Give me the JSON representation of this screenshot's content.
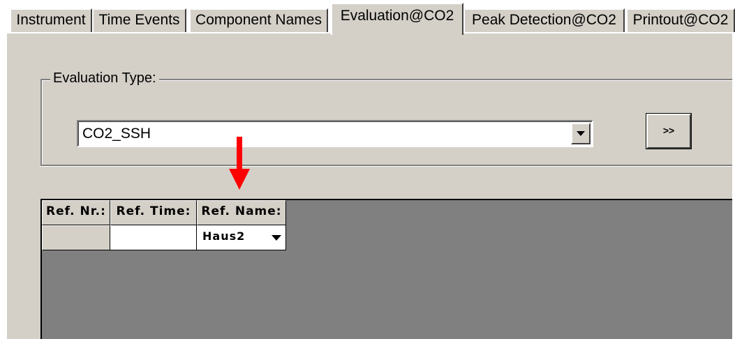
{
  "tabs": [
    {
      "label": "Instrument",
      "active": false
    },
    {
      "label": "Time Events",
      "active": false
    },
    {
      "label": "Component Names",
      "active": false
    },
    {
      "label": "Evaluation@CO2",
      "active": true
    },
    {
      "label": "Peak Detection@CO2",
      "active": false
    },
    {
      "label": "Printout@CO2",
      "active": false
    }
  ],
  "evaluation": {
    "group_label": "Evaluation Type:",
    "selected_type": "CO2_SSH",
    "more_button_label": ">>"
  },
  "ref_table": {
    "columns": [
      "Ref. Nr.:",
      "Ref. Time:",
      "Ref. Name:"
    ],
    "rows": [
      {
        "nr": "",
        "time": "",
        "name": "Haus2"
      }
    ]
  },
  "colors": {
    "panel_background": "#d4d0c8",
    "grid_background": "#808080",
    "annotation_arrow": "#ff0000"
  },
  "icons": {
    "combo_dropdown": "chevron-down-icon",
    "cell_dropdown": "chevron-down-icon",
    "annotation": "red-arrow-down-icon"
  }
}
